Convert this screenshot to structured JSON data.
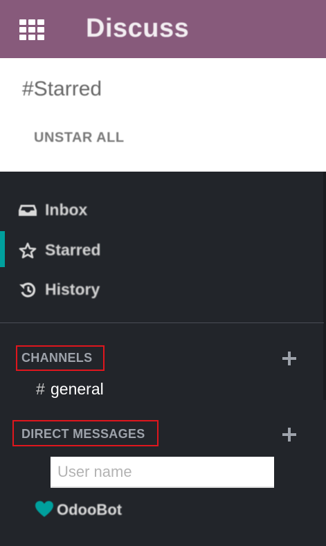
{
  "topbar": {
    "app_title": "Discuss",
    "brand_color": "#875a7b",
    "apps_icon": "grid-icon"
  },
  "control_panel": {
    "title": "#Starred",
    "unstar_all_label": "UNSTAR ALL"
  },
  "sidebar": {
    "accent_color": "#00a09d",
    "mailboxes": [
      {
        "label": "Inbox",
        "icon": "inbox-icon",
        "active": false
      },
      {
        "label": "Starred",
        "icon": "star-icon",
        "active": true
      },
      {
        "label": "History",
        "icon": "history-icon",
        "active": false
      }
    ],
    "channels": {
      "header": "CHANNELS",
      "add_icon": "plus-icon",
      "items": [
        {
          "prefix": "#",
          "name": "general"
        }
      ]
    },
    "direct_messages": {
      "header": "DIRECT MESSAGES",
      "add_icon": "plus-icon",
      "search_placeholder": "User name",
      "search_value": "",
      "items": [
        {
          "name": "OdooBot",
          "icon": "heart-icon",
          "status_color": "#00a09d"
        }
      ]
    }
  }
}
